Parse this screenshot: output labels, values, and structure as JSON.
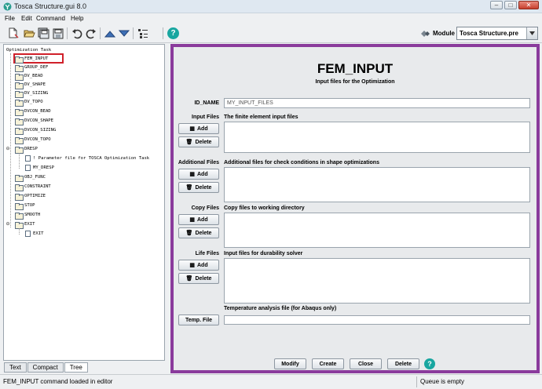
{
  "window": {
    "title": "Tosca Structure.gui 8.0",
    "buttons": {
      "minimize": "‒",
      "maximize": "□",
      "close": "✕"
    }
  },
  "menubar": {
    "items": [
      "File",
      "Edit",
      "Command",
      "Help"
    ]
  },
  "toolbar": {
    "icons": [
      "new-file-icon",
      "open-folder-icon",
      "save-all-icon",
      "save-icon",
      "undo-icon",
      "redo-icon",
      "move-up-icon",
      "move-down-icon",
      "outline-icon",
      "help-icon"
    ],
    "module_label": "Module",
    "module_value": "Tosca Structure.pre"
  },
  "tree": {
    "root": "Optimization Task",
    "nodes": [
      {
        "label": "FEM_INPUT"
      },
      {
        "label": "GROUP_DEF"
      },
      {
        "label": "DV_BEAD"
      },
      {
        "label": "DV_SHAPE"
      },
      {
        "label": "DV_SIZING"
      },
      {
        "label": "DV_TOPO"
      },
      {
        "label": "DVCON_BEAD"
      },
      {
        "label": "DVCON_SHAPE"
      },
      {
        "label": "DVCON_SIZING"
      },
      {
        "label": "DVCON_TOPO"
      },
      {
        "label": "DRESP"
      },
      {
        "label": "! Parameter file for TOSCA Optimization Task"
      },
      {
        "label": "MY_DRESP"
      },
      {
        "label": "OBJ_FUNC"
      },
      {
        "label": "CONSTRAINT"
      },
      {
        "label": "OPTIMIZE"
      },
      {
        "label": "STOP"
      },
      {
        "label": "SMOOTH"
      },
      {
        "label": "EXIT"
      },
      {
        "label": "EXIT"
      }
    ]
  },
  "tabs": [
    "Text",
    "Compact",
    "Tree"
  ],
  "active_tab": "Tree",
  "editor": {
    "title": "FEM_INPUT",
    "subtitle": "Input files for the Optimization",
    "id_name_label": "ID_NAME",
    "id_name_value": "MY_INPUT_FILES",
    "sections": [
      {
        "label": "Input Files",
        "description": "The finite element input files"
      },
      {
        "label": "Additional Files",
        "description": "Additional files for check conditions in shape optimizations"
      },
      {
        "label": "Copy Files",
        "description": "Copy files to working directory"
      },
      {
        "label": "Life Files",
        "description": "Input files for durability solver"
      }
    ],
    "add_label": "Add",
    "delete_label": "Delete",
    "temp_description": "Temperature analysis file (for Abaqus only)",
    "temp_button": "Temp. File",
    "footer_buttons": [
      "Modify",
      "Create",
      "Close",
      "Delete"
    ],
    "help_glyph": "?"
  },
  "status": {
    "message": "FEM_INPUT command loaded in editor",
    "queue": "Queue is empty"
  },
  "colors": {
    "editor_border": "#8a3b9c",
    "highlight_box": "#d0202a",
    "help_icon": "#18a6a0"
  }
}
